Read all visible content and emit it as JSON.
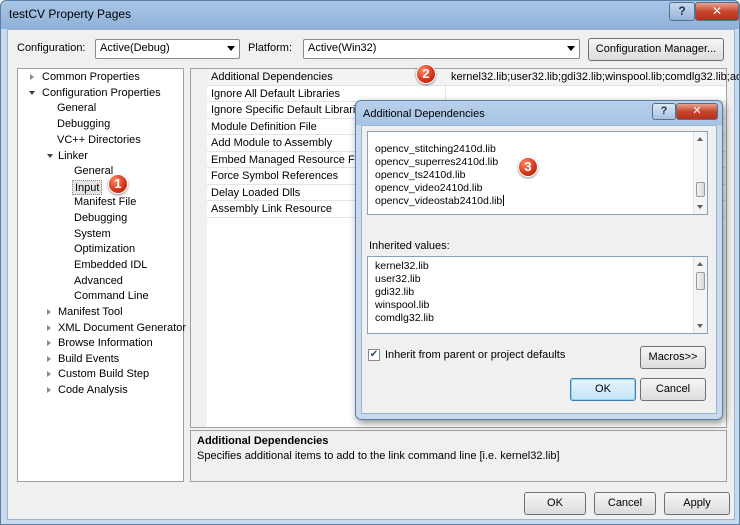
{
  "window": {
    "title": "testCV Property Pages",
    "help_glyph": "?",
    "close_glyph": "✕"
  },
  "toolbar": {
    "configuration_label": "Configuration:",
    "configuration_value": "Active(Debug)",
    "platform_label": "Platform:",
    "platform_value": "Active(Win32)",
    "config_manager_label": "Configuration Manager..."
  },
  "tree": {
    "items": [
      {
        "label": "Common Properties",
        "state": "collapsed"
      },
      {
        "label": "Configuration Properties",
        "state": "expanded"
      },
      {
        "label": "General"
      },
      {
        "label": "Debugging"
      },
      {
        "label": "VC++ Directories"
      },
      {
        "label": "Linker",
        "state": "expanded"
      },
      {
        "label": "General"
      },
      {
        "label": "Input",
        "selected": true
      },
      {
        "label": "Manifest File"
      },
      {
        "label": "Debugging"
      },
      {
        "label": "System"
      },
      {
        "label": "Optimization"
      },
      {
        "label": "Embedded IDL"
      },
      {
        "label": "Advanced"
      },
      {
        "label": "Command Line"
      },
      {
        "label": "Manifest Tool",
        "state": "collapsed"
      },
      {
        "label": "XML Document Generator",
        "state": "collapsed"
      },
      {
        "label": "Browse Information",
        "state": "collapsed"
      },
      {
        "label": "Build Events",
        "state": "collapsed"
      },
      {
        "label": "Custom Build Step",
        "state": "collapsed"
      },
      {
        "label": "Code Analysis",
        "state": "collapsed"
      }
    ]
  },
  "grid": {
    "rows": [
      {
        "name": "Additional Dependencies",
        "value": "kernel32.lib;user32.lib;gdi32.lib;winspool.lib;comdlg32.lib;ad"
      },
      {
        "name": "Ignore All Default Libraries",
        "value": ""
      },
      {
        "name": "Ignore Specific Default Libraries",
        "value": ""
      },
      {
        "name": "Module Definition File",
        "value": ""
      },
      {
        "name": "Add Module to Assembly",
        "value": ""
      },
      {
        "name": "Embed Managed Resource File",
        "value": ""
      },
      {
        "name": "Force Symbol References",
        "value": ""
      },
      {
        "name": "Delay Loaded Dlls",
        "value": ""
      },
      {
        "name": "Assembly Link Resource",
        "value": ""
      }
    ]
  },
  "description": {
    "title": "Additional Dependencies",
    "text": "Specifies additional items to add to the link command line [i.e. kernel32.lib]"
  },
  "footer": {
    "ok": "OK",
    "cancel": "Cancel",
    "apply": "Apply"
  },
  "badges": {
    "one": "1",
    "two": "2",
    "three": "3"
  },
  "dialog": {
    "title": "Additional Dependencies",
    "help_glyph": "?",
    "close_glyph": "✕",
    "editor_lines": [
      "opencv_stitching2410d.lib",
      "opencv_superres2410d.lib",
      "opencv_ts2410d.lib",
      "opencv_video2410d.lib",
      "opencv_videostab2410d.lib"
    ],
    "inherited_label": "Inherited values:",
    "inherited_lines": [
      "kernel32.lib",
      "user32.lib",
      "gdi32.lib",
      "winspool.lib",
      "comdlg32.lib"
    ],
    "inherit_checkbox_label": "Inherit from parent or project defaults",
    "inherit_checked": true,
    "check_glyph": "✔",
    "macros_label": "Macros>>",
    "ok": "OK",
    "cancel": "Cancel"
  }
}
